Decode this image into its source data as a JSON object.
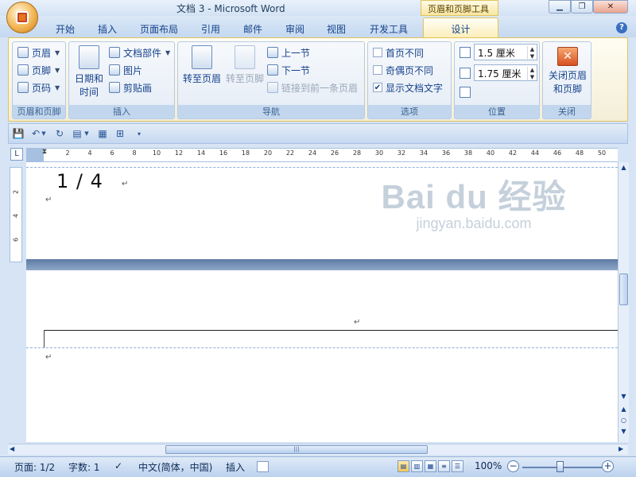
{
  "window": {
    "doc_title": "文档 3 - Microsoft Word",
    "context_tool_title": "页眉和页脚工具"
  },
  "tabs": [
    "开始",
    "插入",
    "页面布局",
    "引用",
    "邮件",
    "审阅",
    "视图",
    "开发工具"
  ],
  "active_tab": "设计",
  "ribbon": {
    "header_footer": {
      "label": "页眉和页脚",
      "items": [
        "页眉",
        "页脚",
        "页码"
      ]
    },
    "insert": {
      "label": "插入",
      "date_time": "日期和\n时间",
      "date_time_l1": "日期和",
      "date_time_l2": "时间",
      "items": [
        "文档部件",
        "图片",
        "剪贴画"
      ]
    },
    "navigation": {
      "label": "导航",
      "goto_header": "转至页眉",
      "goto_footer": "转至页脚",
      "prev": "上一节",
      "next": "下一节",
      "link_prev": "链接到前一条页眉"
    },
    "options": {
      "label": "选项",
      "first_page": "首页不同",
      "odd_even": "奇偶页不同",
      "show_text": "显示文档文字",
      "show_text_checked": true
    },
    "position": {
      "label": "位置",
      "header_dist": "1.5 厘米",
      "footer_dist": "1.75 厘米"
    },
    "close": {
      "label": "关闭",
      "button_l1": "关闭页眉",
      "button_l2": "和页脚"
    }
  },
  "ruler": {
    "ticks": [
      "2",
      "4",
      "6",
      "8",
      "10",
      "12",
      "14",
      "16",
      "18",
      "20",
      "22",
      "24",
      "26",
      "28",
      "30",
      "32",
      "34",
      "36",
      "38",
      "40",
      "42",
      "44",
      "46",
      "48",
      "50"
    ],
    "vticks": [
      "2",
      "4",
      "6"
    ],
    "corner": "L"
  },
  "document": {
    "page_number_text": "1 / 4",
    "para_mark": "↵"
  },
  "watermark": {
    "logo": "Bai du 经验",
    "url": "jingyan.baidu.com"
  },
  "statusbar": {
    "page": "页面: 1/2",
    "words": "字数: 1",
    "language": "中文(简体，中国)",
    "mode": "插入",
    "zoom": "100%"
  },
  "colors": {
    "ribbon_bg": "#fffdf3",
    "context_tab": "#fbeeb9",
    "accent": "#15428b"
  }
}
